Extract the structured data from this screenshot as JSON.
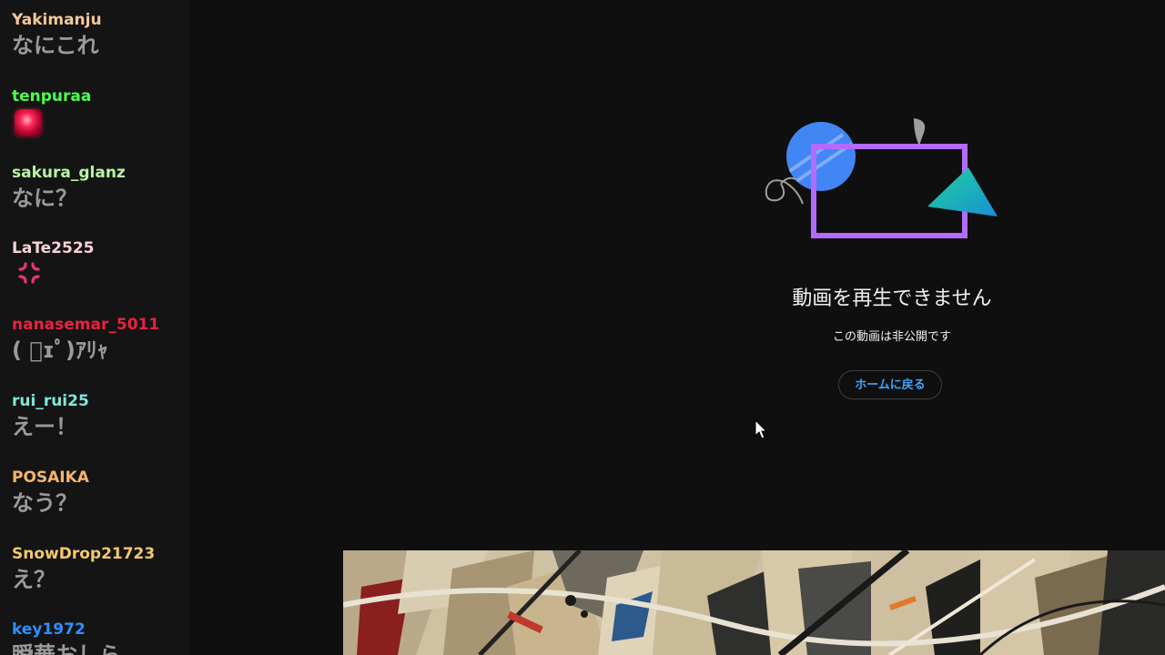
{
  "chat": {
    "messages": [
      {
        "user": "Yakimanju",
        "text": "なにこれ",
        "user_color": "#f6c79b"
      },
      {
        "user": "tenpuraa",
        "emote": "red-glowing-emote",
        "user_color": "#4cff4c"
      },
      {
        "user": "sakura_glanz",
        "text": "なに？",
        "user_color": "#b7f5a3"
      },
      {
        "user": "LaTe2525",
        "emote": "anger-mark-icon",
        "user_color": "#f7d3d9"
      },
      {
        "user": "nanasemar_5011",
        "text": "( ﾟɪﾟ)ｱﾘｬ",
        "user_color": "#e8233f"
      },
      {
        "user": "rui_rui25",
        "text": "えー！",
        "user_color": "#7ee8d8"
      },
      {
        "user": "POSAIKA",
        "text": "なう？",
        "user_color": "#f4b46c"
      },
      {
        "user": "SnowDrop21723",
        "text": "え？",
        "user_color": "#f4c86c"
      },
      {
        "user": "key1972",
        "text": "瞬華おしら",
        "user_color": "#2f8fff"
      }
    ]
  },
  "player_error": {
    "title": "動画を再生できません",
    "subtitle": "この動画は非公開です",
    "home_button_label": "ホームに戻る",
    "illustration": "broken-shapes-illustration"
  },
  "colors": {
    "background": "#0f0f0f",
    "chat_background": "#141414",
    "chat_text": "#9a9a9a",
    "link_blue": "#3ea6ff",
    "illustration_purple": "#b36bff",
    "illustration_blue": "#4285f4",
    "illustration_teal": "#19c3a3"
  }
}
